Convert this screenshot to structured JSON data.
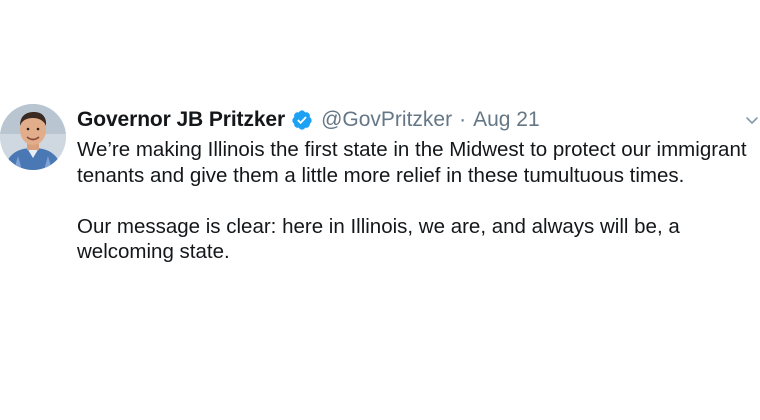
{
  "tweet": {
    "display_name": "Governor JB Pritzker",
    "verified_icon": "verified-badge-icon",
    "handle": "@GovPritzker",
    "separator": "·",
    "date": "Aug 21",
    "menu_icon": "chevron-down-icon",
    "paragraphs": [
      "We’re making Illinois the first state in the Midwest to protect our immigrant tenants and give them a little more relief in these tumultuous times.",
      "Our message is clear: here in Illinois, we are, and always will be, a welcoming state."
    ]
  },
  "colors": {
    "text_primary": "#14171a",
    "text_secondary": "#657786",
    "verified_blue": "#1da1f2"
  }
}
